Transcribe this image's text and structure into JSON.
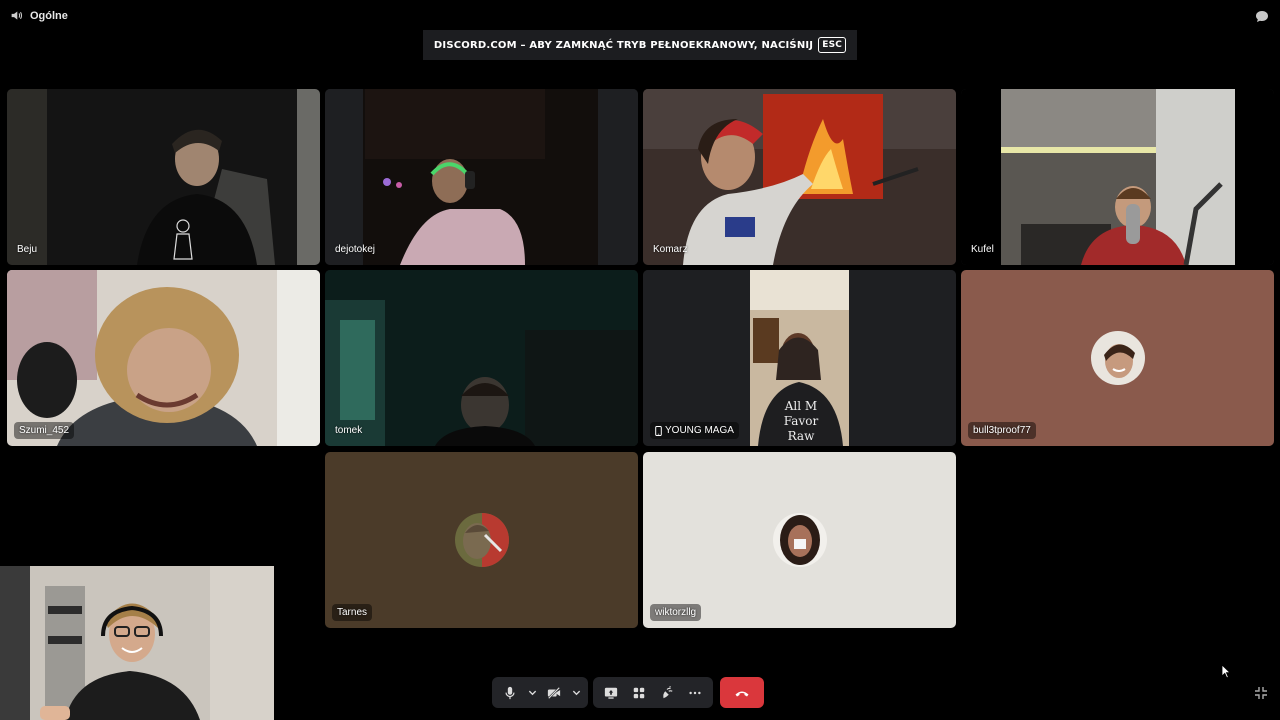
{
  "channel": {
    "name": "Ogólne",
    "icon": "speaker-icon"
  },
  "banner": {
    "text": "discord.com – aby zamknąć tryb pełnoekranowy, naciśnij",
    "key": "Esc"
  },
  "tiles": [
    {
      "name": "Beju",
      "type": "video"
    },
    {
      "name": "dejotokej",
      "type": "video"
    },
    {
      "name": "Komarz",
      "type": "video"
    },
    {
      "name": "Kufel",
      "type": "video"
    },
    {
      "name": "Szumi_452",
      "type": "video"
    },
    {
      "name": "tomek",
      "type": "video"
    },
    {
      "name": "YOUNG MAGA",
      "type": "video",
      "device_icon": "phone-icon"
    },
    {
      "name": "bull3tproof77",
      "type": "avatar",
      "bg": "#8a5a4c"
    },
    {
      "name": "Tarnes",
      "type": "avatar",
      "bg": "#4b3b29"
    },
    {
      "name": "wiktorzllg",
      "type": "avatar",
      "bg": "#e3e1dc"
    }
  ],
  "controls": {
    "mic": "microphone-icon",
    "mic_options": "chevron-down-icon",
    "camera": "camera-off-icon",
    "camera_options": "chevron-down-icon",
    "screen_share": "screen-share-icon",
    "activities": "activities-icon",
    "soundboard": "soundboard-icon",
    "more": "more-icon",
    "disconnect": "phone-hangup-icon"
  },
  "colors": {
    "background": "#000000",
    "tile": "#1e1f22",
    "hangup": "#da373c",
    "controls_bg": "#232428"
  }
}
